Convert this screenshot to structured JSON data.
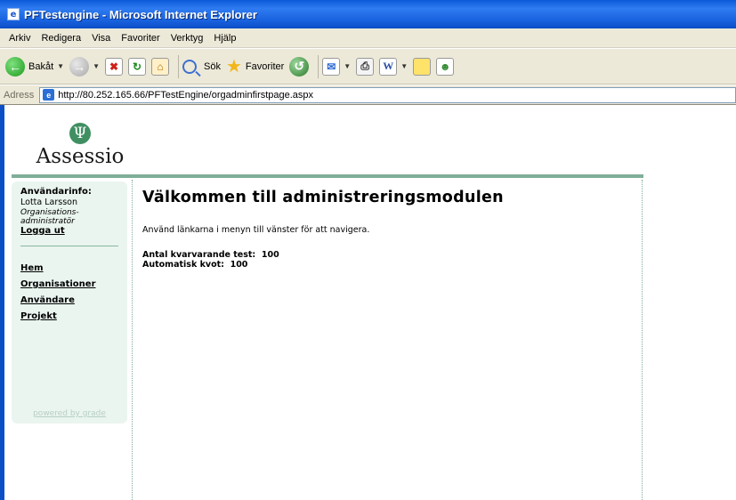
{
  "window": {
    "title": "PFTestengine - Microsoft Internet Explorer"
  },
  "menubar": {
    "items": [
      {
        "label": "Arkiv"
      },
      {
        "label": "Redigera"
      },
      {
        "label": "Visa"
      },
      {
        "label": "Favoriter"
      },
      {
        "label": "Verktyg"
      },
      {
        "label": "Hjälp"
      }
    ]
  },
  "toolbar": {
    "back_label": "Bakåt",
    "search_label": "Sök",
    "favorites_label": "Favoriter",
    "icons": [
      "back-icon",
      "forward-icon",
      "stop-icon",
      "refresh-icon",
      "home-icon",
      "search-icon",
      "favorites-icon",
      "history-icon",
      "mail-icon",
      "print-icon",
      "word-icon",
      "note-icon",
      "messenger-icon"
    ]
  },
  "addressbar": {
    "label": "Adress",
    "url": "http://80.252.165.66/PFTestEngine/orgadminfirstpage.aspx"
  },
  "logo": {
    "symbol": "Ψ",
    "text": "Assessio"
  },
  "sidebar": {
    "user_info_heading": "Användarinfo:",
    "user_name": "Lotta Larsson",
    "user_role_line1": "Organisations-",
    "user_role_line2": "administratör",
    "logout_label": "Logga ut",
    "nav": [
      {
        "label": "Hem"
      },
      {
        "label": "Organisationer"
      },
      {
        "label": "Användare"
      },
      {
        "label": "Projekt"
      }
    ],
    "powered_by": "powered by grade"
  },
  "main": {
    "heading": "Välkommen till administreringsmodulen",
    "intro": "Använd länkarna i menyn till vänster för att navigera.",
    "remaining_tests_label": "Antal kvarvarande test:",
    "remaining_tests_value": "100",
    "auto_quota_label": "Automatisk kvot:",
    "auto_quota_value": "100"
  },
  "colors": {
    "accent_green": "#7fae98",
    "sidebar_bg": "#eaf5ef",
    "logo_green": "#3f8f62"
  }
}
